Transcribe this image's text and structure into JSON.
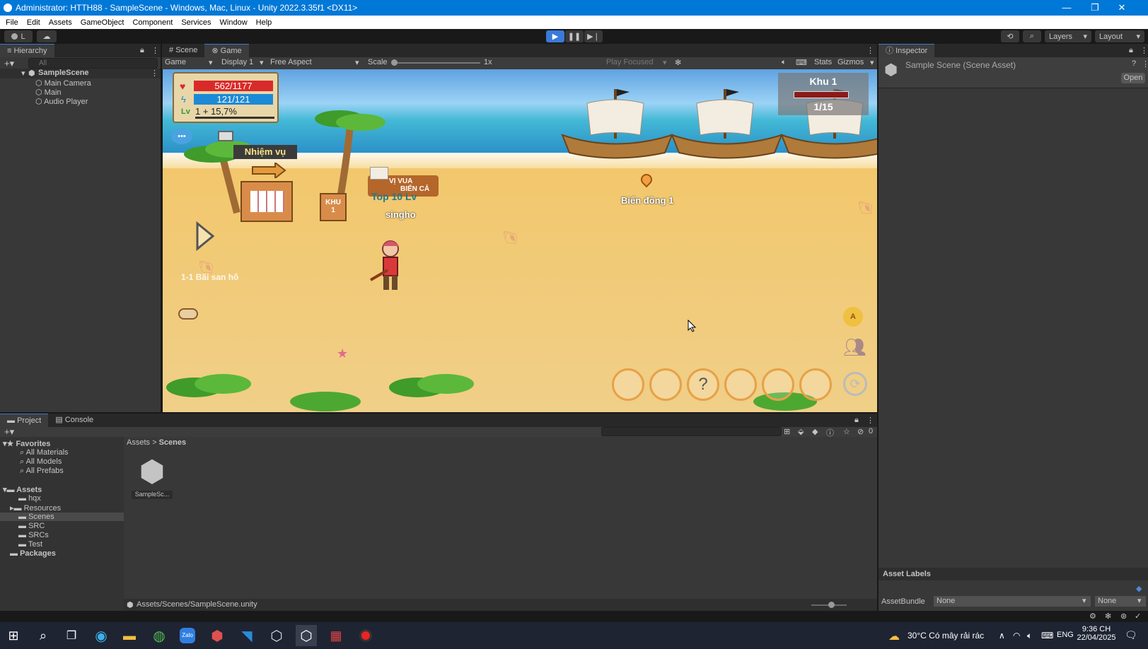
{
  "window": {
    "title": "Administrator: HTTH88 - SampleScene - Windows, Mac, Linux - Unity 2022.3.35f1 <DX11>",
    "minimize": "—",
    "restore": "❐",
    "close": "✕"
  },
  "menu": [
    "File",
    "Edit",
    "Assets",
    "GameObject",
    "Component",
    "Services",
    "Window",
    "Help"
  ],
  "toolbar": {
    "account": "L",
    "layers": "Layers",
    "layout": "Layout"
  },
  "hierarchy": {
    "tab": "Hierarchy",
    "search_placeholder": "All",
    "scene": "SampleScene",
    "items": [
      "Main Camera",
      "Main",
      "Audio Player"
    ]
  },
  "game_view": {
    "tabs": [
      "Scene",
      "Game"
    ],
    "mode": "Game",
    "display": "Display 1",
    "aspect": "Free Aspect",
    "scale_label": "Scale",
    "scale_value": "1x",
    "play_focused": "Play Focused",
    "stats": "Stats",
    "gizmos": "Gizmos"
  },
  "game": {
    "hp": "562/1177",
    "mp": "121/121",
    "level": "1 + 15,7%",
    "quest": "Nhiệm vụ",
    "zone_title": "Khu 1",
    "zone_count": "1/15",
    "khu_sign_top": "KHU",
    "khu_sign_num": "1",
    "banner_line1": "VỊ VUA",
    "banner_line2": "BIỂN CẢ",
    "top_label": "Top 10 Lv",
    "player_name": "singho",
    "npc_label": "Biển đông 1",
    "map_label": "1-1 Bãi san hô",
    "help_symbol": "?",
    "auto_symbol": "A"
  },
  "inspector": {
    "tab": "Inspector",
    "title": "Sample Scene (Scene Asset)",
    "open": "Open",
    "asset_labels": "Asset Labels",
    "asset_bundle": "AssetBundle",
    "bundle_value": "None",
    "variant_value": "None"
  },
  "project": {
    "tabs": [
      "Project",
      "Console"
    ],
    "favorites": "Favorites",
    "fav_items": [
      "All Materials",
      "All Models",
      "All Prefabs"
    ],
    "assets": "Assets",
    "asset_folders": [
      "hqx",
      "Resources",
      "Scenes",
      "SRC",
      "SRCs",
      "Test"
    ],
    "packages": "Packages",
    "breadcrumb_root": "Assets",
    "breadcrumb_sep": ">",
    "breadcrumb_current": "Scenes",
    "file_label": "SampleSc...",
    "path": "Assets/Scenes/SampleScene.unity",
    "hidden_count": "0"
  },
  "taskbar": {
    "weather": "30°C  Có mây rải rác",
    "lang": "ENG",
    "time": "9:36 CH",
    "date": "22/04/2025"
  },
  "colors": {
    "accent": "#3a7ad8",
    "titlebar": "#0078d7",
    "hp": "#d92a2a",
    "mp": "#1d8ad6"
  }
}
